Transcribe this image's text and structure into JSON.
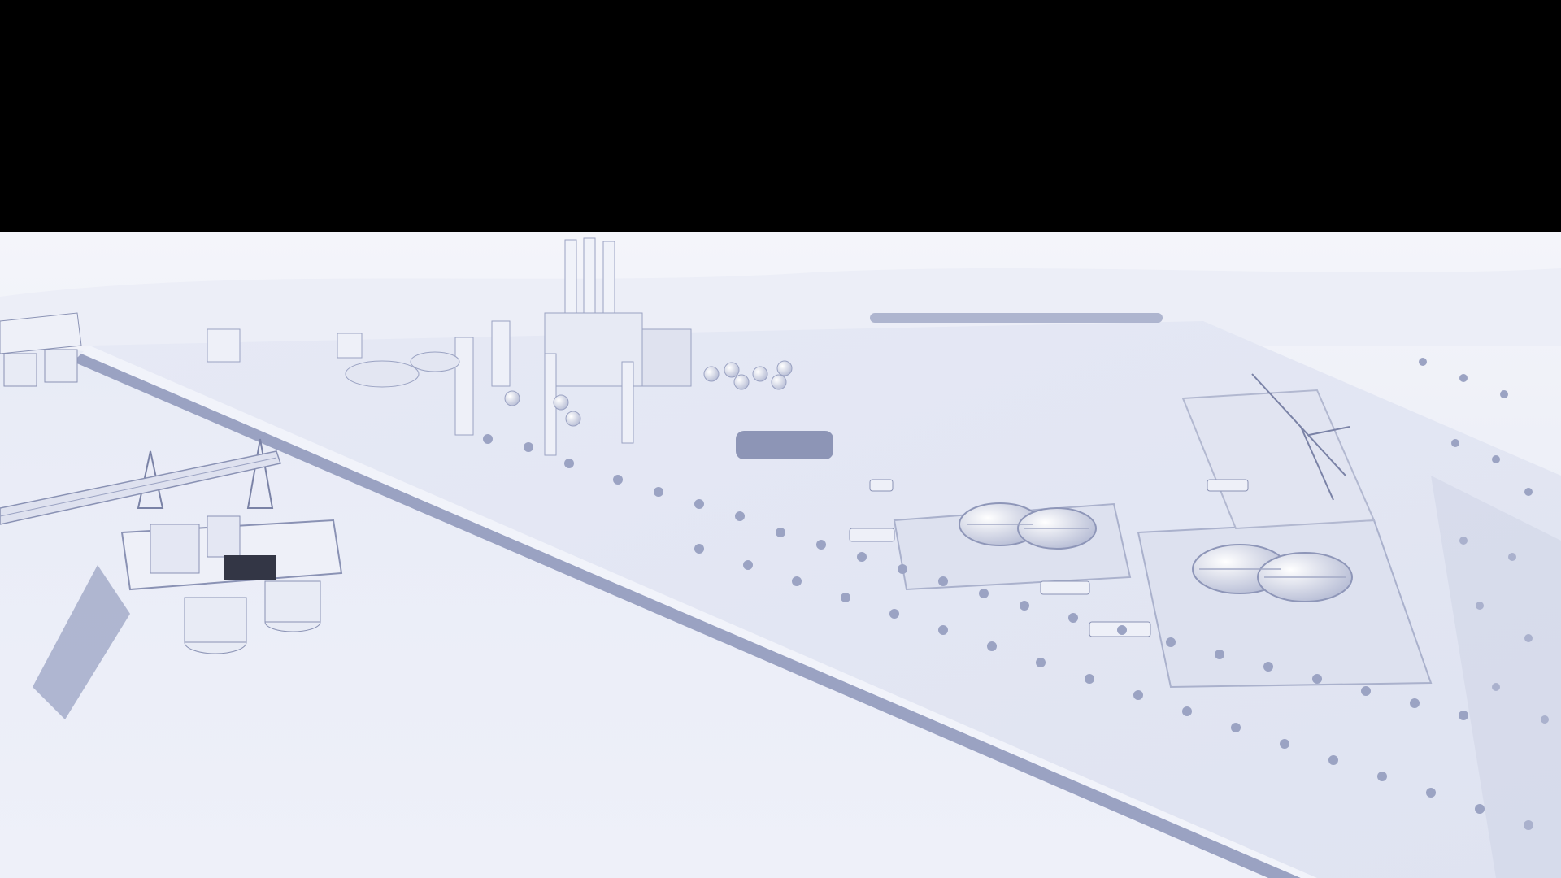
{
  "scene": {
    "kind": "clay render of an industrial coastal complex",
    "palette": {
      "ground": "#e4e8f5",
      "sea": "#eceef8",
      "sky_haze": "#f1f2f8",
      "structure_light": "#f3f4f9",
      "structure_mid": "#c8cde0",
      "shadow": "#8a94b8",
      "shadow_deep": "#5e6890",
      "letterbox": "#000000"
    },
    "elements": [
      "offshore-platform",
      "offshore-pipeline-trestle",
      "seawall",
      "palm-trees",
      "refinery-stacks",
      "storage-spheres",
      "clarifier-tanks",
      "cranes",
      "trucks",
      "bus",
      "forest"
    ]
  }
}
